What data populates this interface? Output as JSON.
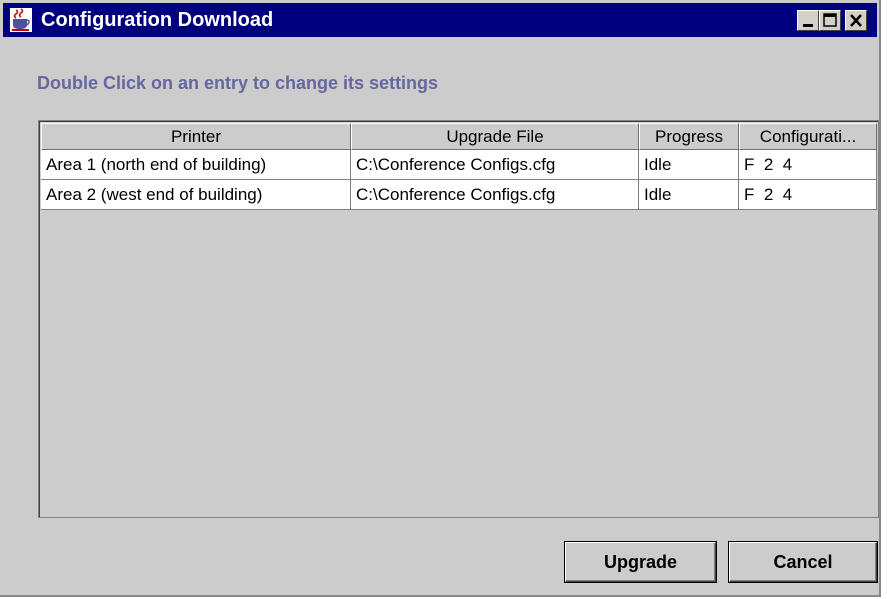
{
  "window": {
    "title": "Configuration Download",
    "titlebar_color": "#00007f",
    "background_color": "#cccccc"
  },
  "instruction": "Double Click on an entry to change its settings",
  "table": {
    "columns": [
      "Printer",
      "Upgrade File",
      "Progress",
      "Configurati..."
    ],
    "rows": [
      {
        "printer": "Area 1 (north end of building)",
        "upgrade_file": "C:\\Conference Configs.cfg",
        "progress": "Idle",
        "configuration": "F  2  4"
      },
      {
        "printer": "Area 2 (west end of building)",
        "upgrade_file": "C:\\Conference Configs.cfg",
        "progress": "Idle",
        "configuration": "F  2  4"
      }
    ]
  },
  "buttons": {
    "upgrade": "Upgrade",
    "cancel": "Cancel"
  },
  "icons": {
    "app": "java-coffee-cup-icon",
    "minimize": "minimize-icon",
    "maximize": "maximize-icon",
    "close": "close-icon"
  }
}
